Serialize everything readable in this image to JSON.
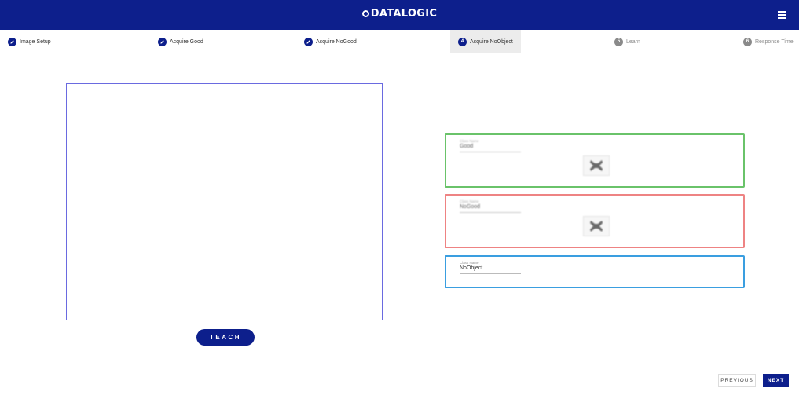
{
  "header": {
    "logo_text": "DATALOGIC",
    "menu_icon": "hamburger-menu-icon",
    "background": "#0d1f8c"
  },
  "stepper": {
    "steps": [
      {
        "label": "Image Setup",
        "state": "done",
        "icon": "pencil-icon"
      },
      {
        "label": "Acquire Good",
        "state": "done",
        "icon": "pencil-icon"
      },
      {
        "label": "Acquire NoGood",
        "state": "done",
        "icon": "pencil-icon"
      },
      {
        "label": "Acquire NoObject",
        "state": "active",
        "number": "4"
      },
      {
        "label": "Learn",
        "state": "pending",
        "number": "5"
      },
      {
        "label": "Response Time",
        "state": "pending",
        "number": "6"
      }
    ]
  },
  "actions": {
    "teach_label": "TEACH",
    "previous_label": "PREVIOUS",
    "next_label": "NEXT"
  },
  "classes": [
    {
      "field_label": "Class Name",
      "value": "Good",
      "border_color": "#6ac36a",
      "has_thumbnail": true
    },
    {
      "field_label": "Class Name",
      "value": "NoGood",
      "border_color": "#ee8383",
      "has_thumbnail": true
    },
    {
      "field_label": "Class Name",
      "value": "NoObject",
      "border_color": "#3a9ee0",
      "has_thumbnail": false
    }
  ]
}
